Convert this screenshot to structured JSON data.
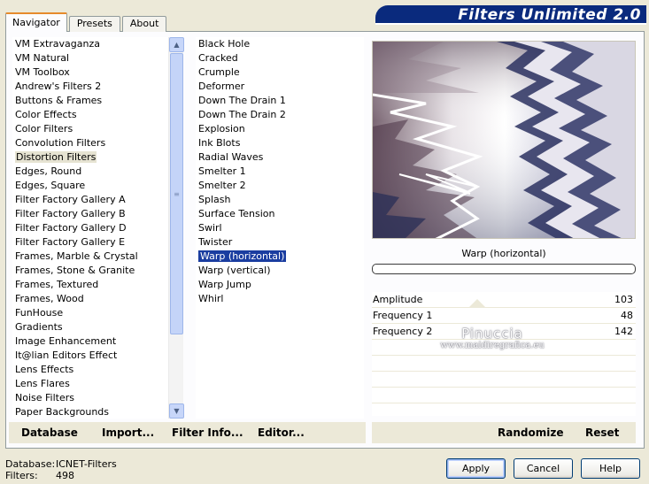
{
  "tabs": [
    {
      "label": "Navigator",
      "active": true
    },
    {
      "label": "Presets",
      "active": false
    },
    {
      "label": "About",
      "active": false
    }
  ],
  "banner": {
    "title": "Filters Unlimited 2.0"
  },
  "categories": [
    "VM Extravaganza",
    "VM Natural",
    "VM Toolbox",
    "Andrew's Filters 2",
    "Buttons & Frames",
    "Color Effects",
    "Color Filters",
    "Convolution Filters",
    "Distortion Filters",
    "Edges, Round",
    "Edges, Square",
    "Filter Factory Gallery A",
    "Filter Factory Gallery B",
    "Filter Factory Gallery D",
    "Filter Factory Gallery E",
    "Frames, Marble & Crystal",
    "Frames, Stone & Granite",
    "Frames, Textured",
    "Frames, Wood",
    "FunHouse",
    "Gradients",
    "Image Enhancement",
    "It@lian Editors Effect",
    "Lens Effects",
    "Lens Flares",
    "Noise Filters",
    "Paper Backgrounds"
  ],
  "selected_category": "Distortion Filters",
  "filters": [
    "Black Hole",
    "Cracked",
    "Crumple",
    "Deformer",
    "Down The Drain 1",
    "Down The Drain 2",
    "Explosion",
    "Ink Blots",
    "Radial Waves",
    "Smelter 1",
    "Smelter 2",
    "Splash",
    "Surface Tension",
    "Swirl",
    "Twister",
    "Warp (horizontal)",
    "Warp (vertical)",
    "Warp Jump",
    "Whirl"
  ],
  "selected_filter": "Warp (horizontal)",
  "preview_title": "Warp (horizontal)",
  "progress": 0,
  "params": [
    {
      "label": "Amplitude",
      "value": "103"
    },
    {
      "label": "Frequency 1",
      "value": "48"
    },
    {
      "label": "Frequency 2",
      "value": "142"
    }
  ],
  "watermark": {
    "name": "Pinuccia",
    "url": "www.maidiregrafica.eu"
  },
  "buttons_left": {
    "database": "Database",
    "import": "Import...",
    "filter_info": "Filter Info...",
    "editor": "Editor..."
  },
  "buttons_right": {
    "randomize": "Randomize",
    "reset": "Reset"
  },
  "status": {
    "database_label": "Database:",
    "database_value": "ICNET-Filters",
    "filters_label": "Filters:",
    "filters_value": "498"
  },
  "dialog": {
    "apply": "Apply",
    "cancel": "Cancel",
    "help": "Help"
  },
  "colors": {
    "selection": "#1a3da0",
    "banner": "#0a2a7d",
    "face": "#ece9d8"
  }
}
